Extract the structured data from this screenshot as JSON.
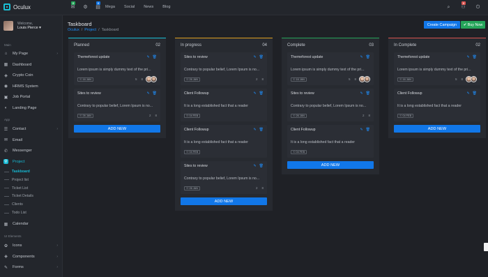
{
  "app": {
    "name": "Oculux"
  },
  "topbar": {
    "icons": [
      {
        "name": "mail-icon",
        "glyph": "✉",
        "badge": "8",
        "badge_color": "#25a55a"
      },
      {
        "name": "gear-icon",
        "glyph": "⚙",
        "badge": "",
        "badge_color": ""
      },
      {
        "name": "chat-icon",
        "glyph": "▤",
        "badge": "8",
        "badge_color": "#1177e8"
      }
    ],
    "nav": [
      "Mega",
      "Social",
      "News",
      "Blog"
    ],
    "right_icons": [
      {
        "name": "search-icon",
        "glyph": "⌕",
        "badge": ""
      },
      {
        "name": "bell-icon",
        "glyph": "⚇",
        "badge": "8"
      },
      {
        "name": "power-icon",
        "glyph": "⏻",
        "badge": ""
      }
    ]
  },
  "user": {
    "welcome": "Welcome,",
    "name": "Louis Pierce ▾"
  },
  "sidebar": {
    "sections": {
      "main": "Main",
      "app": "App",
      "ui": "UI Elements"
    },
    "main_items": [
      {
        "id": "my-page",
        "icon": "⌂",
        "label": "My Page",
        "chev": "›"
      },
      {
        "id": "dashboard",
        "icon": "▦",
        "label": "Dashboard",
        "chev": ""
      },
      {
        "id": "crypto-coin",
        "icon": "◈",
        "label": "Crypto Coin",
        "chev": ""
      },
      {
        "id": "hrms-system",
        "icon": "◉",
        "label": "HRMS System",
        "chev": ""
      },
      {
        "id": "job-portal",
        "icon": "▣",
        "label": "Job Portal",
        "chev": ""
      },
      {
        "id": "landing-page",
        "icon": "◐",
        "label": "Landing Page",
        "chev": ""
      }
    ],
    "app_items": [
      {
        "id": "contact",
        "icon": "☰",
        "label": "Contact",
        "chev": "›"
      },
      {
        "id": "email",
        "icon": "✉",
        "label": "Email",
        "chev": ""
      },
      {
        "id": "messenger",
        "icon": "✆",
        "label": "Messenger",
        "chev": ""
      },
      {
        "id": "project",
        "icon": "⚲",
        "label": "Project",
        "chev": ""
      }
    ],
    "project_sub": [
      "Taskboard",
      "Project list",
      "Ticket List",
      "Ticket Details",
      "Clients",
      "Todo List"
    ],
    "calendar": {
      "icon": "▦",
      "label": "Calendar"
    },
    "ui_items": [
      {
        "id": "icons",
        "icon": "✿",
        "label": "Icons",
        "chev": "›"
      },
      {
        "id": "components",
        "icon": "◈",
        "label": "Components",
        "chev": "›"
      },
      {
        "id": "forms",
        "icon": "✎",
        "label": "Forms",
        "chev": "›"
      }
    ]
  },
  "page": {
    "title": "Taskboard",
    "breadcrumb": [
      "Oculux",
      "Project",
      "Taskboard"
    ],
    "btn_campaign": "Create Campaign",
    "btn_buy": "✔ Buy Now"
  },
  "board": {
    "add_label": "ADD NEW",
    "columns": [
      {
        "title": "Planned",
        "count": "02",
        "accent": "#19c0d6",
        "cards": [
          {
            "title": "Themeforest update",
            "text": "Lorem ipsum is simply dummy text of the pri...",
            "date": "☉ 16 JAN",
            "c1": "5",
            "c2": "8",
            "avatars": true
          },
          {
            "title": "Sites to review",
            "text": "Contrary to popular belief, Lorem Ipsum is no...",
            "date": "☉ 26 JAN",
            "c1": "2",
            "c2": "8",
            "avatars": false
          }
        ]
      },
      {
        "title": "In progress",
        "count": "04",
        "accent": "#e0a020",
        "cards": [
          {
            "title": "Sites to review",
            "text": "Contrary to popular belief, Lorem Ipsum is no...",
            "date": "☉ 26 JAN",
            "c1": "2",
            "c2": "8",
            "avatars": false
          },
          {
            "title": "Client Followup",
            "text": "It is a long established fact that a reader",
            "date": "☉ 04 FEB",
            "c1": "",
            "c2": "",
            "avatars": false
          },
          {
            "title": "Client Followup",
            "text": "It is a long established fact that a reader",
            "date": "☉ 04 FEB",
            "c1": "",
            "c2": "",
            "avatars": false
          },
          {
            "title": "Sites to review",
            "text": "Contrary to popular belief, Lorem Ipsum is no...",
            "date": "☉ 26 JAN",
            "c1": "2",
            "c2": "8",
            "avatars": false
          }
        ]
      },
      {
        "title": "Complete",
        "count": "03",
        "accent": "#25a55a",
        "cards": [
          {
            "title": "Themeforest update",
            "text": "Lorem ipsum is simply dummy text of the pri...",
            "date": "☉ 16 JAN",
            "c1": "5",
            "c2": "8",
            "avatars": true
          },
          {
            "title": "Sites to review",
            "text": "Contrary to popular belief, Lorem Ipsum is no...",
            "date": "☉ 26 JAN",
            "c1": "2",
            "c2": "8",
            "avatars": false
          },
          {
            "title": "Client Followup",
            "text": "It is a long established fact that a reader",
            "date": "☉ 04 FEB",
            "c1": "",
            "c2": "",
            "avatars": false
          }
        ]
      },
      {
        "title": "In Complete",
        "count": "02",
        "accent": "#d9534f",
        "cards": [
          {
            "title": "Themeforest update",
            "text": "Lorem ipsum is simply dummy text of the pri...",
            "date": "☉ 16 JAN",
            "c1": "5",
            "c2": "8",
            "avatars": true
          },
          {
            "title": "Client Followup",
            "text": "It is a long established fact that a reader",
            "date": "☉ 04 FEB",
            "c1": "",
            "c2": "",
            "avatars": false
          }
        ]
      }
    ]
  }
}
